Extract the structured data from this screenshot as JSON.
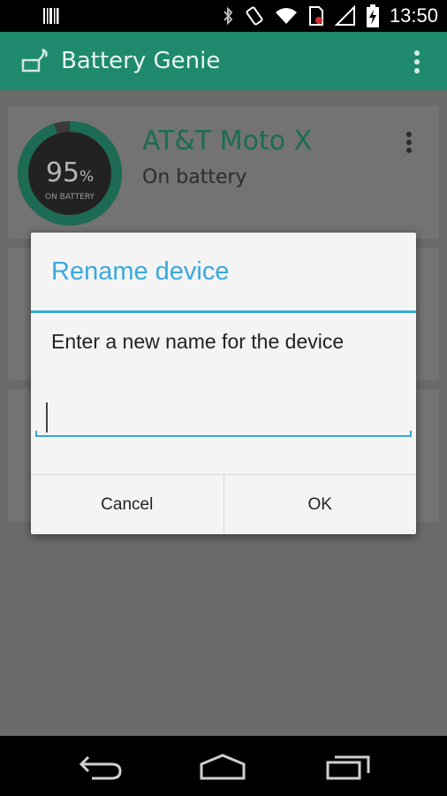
{
  "status_bar": {
    "time": "13:50"
  },
  "action_bar": {
    "title": "Battery Genie",
    "icon": "battery-genie-lamp-icon",
    "accent_color": "#1f8a6d"
  },
  "device_card": {
    "gauge_percent": "95",
    "gauge_unit": "%",
    "gauge_level": 0.95,
    "gauge_caption": "ON BATTERY",
    "name": "AT&T Moto X",
    "status": "On battery"
  },
  "dialog": {
    "title": "Rename device",
    "message": "Enter a new name for the device",
    "input_value": "",
    "cancel_label": "Cancel",
    "ok_label": "OK",
    "accent_color": "#38a9dd"
  },
  "nav_bar": {
    "icons": [
      "back-icon",
      "home-icon",
      "recent-apps-icon"
    ]
  }
}
